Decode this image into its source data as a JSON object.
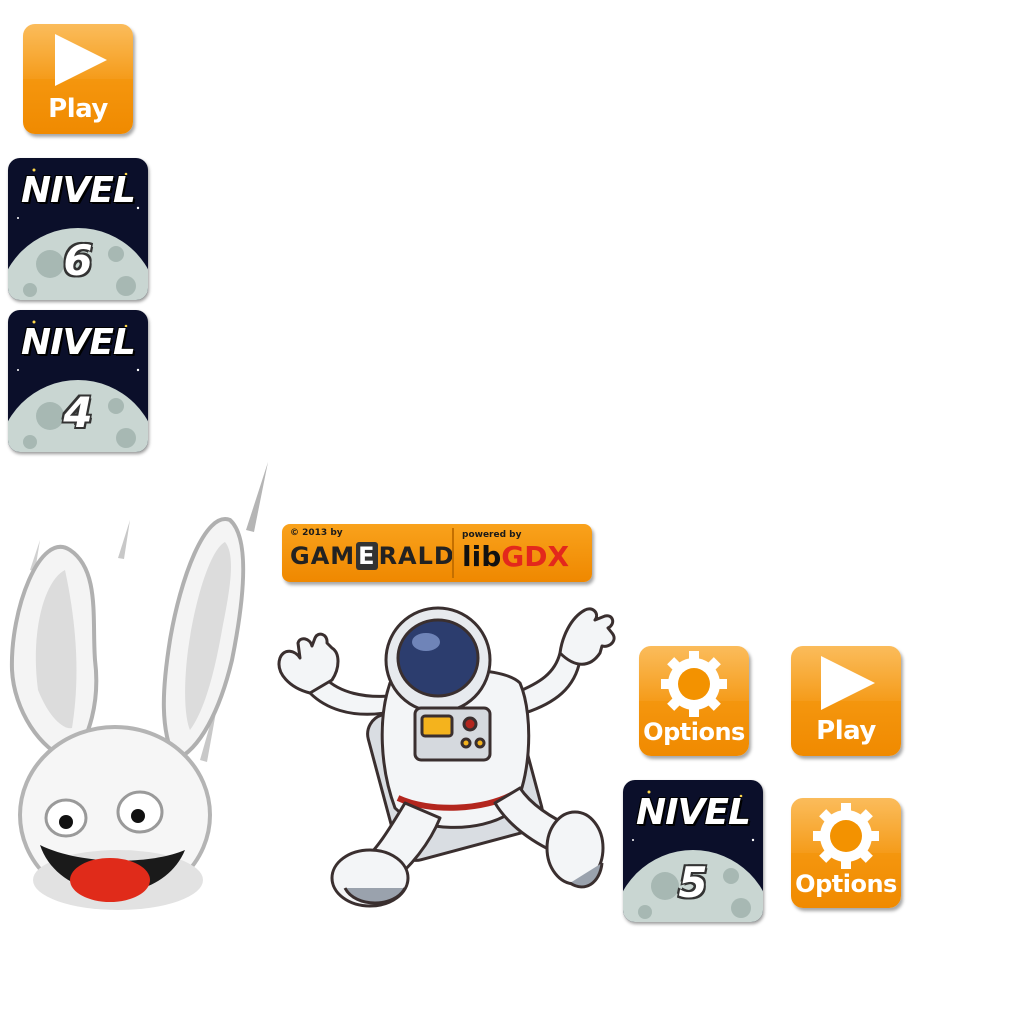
{
  "buttons": {
    "play_top": "Play",
    "options_mid": "Options",
    "play_right": "Play",
    "options_bottom": "Options"
  },
  "levels": {
    "title": "NIVEL",
    "level_6": "6",
    "level_4": "4",
    "level_5": "5"
  },
  "logo": {
    "copyright": "© 2013 by",
    "brand_left": "GAM",
    "brand_e": "E",
    "brand_right": "RALD",
    "powered": "powered by",
    "lib": "lib",
    "gdx": "GDX"
  },
  "colors": {
    "orange": "#f39200",
    "tile_bg": "#0b0f2a",
    "moon": "#c9d6d2"
  },
  "icons": [
    "play-icon",
    "gear-icon",
    "moon-icon",
    "bunny-character",
    "astronaut-character"
  ]
}
